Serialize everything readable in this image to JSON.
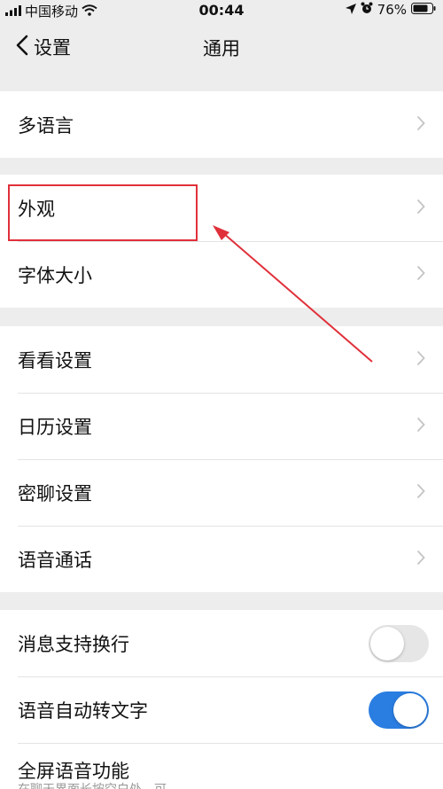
{
  "status_bar": {
    "carrier": "中国移动",
    "time": "00:44",
    "battery": "76%"
  },
  "nav": {
    "back_label": "设置",
    "title": "通用"
  },
  "sections": {
    "language": "多语言",
    "appearance": "外观",
    "font_size": "字体大小",
    "look_settings": "看看设置",
    "calendar_settings": "日历设置",
    "private_chat_settings": "密聊设置",
    "voice_call": "语音通话",
    "message_line_break": {
      "label": "消息支持换行",
      "enabled": false
    },
    "voice_to_text": {
      "label": "语音自动转文字",
      "enabled": true
    },
    "fullscreen_voice": "全屏语音功能",
    "cut_off_text": "在聊天界面长按空白处，可"
  },
  "colors": {
    "accent": "#2a7de1",
    "highlight": "#e0303a",
    "background": "#ededed"
  },
  "icons": [
    "signal-icon",
    "wifi-icon",
    "location-icon",
    "alarm-icon",
    "battery-icon",
    "back-chevron-icon",
    "chevron-right-icon"
  ]
}
